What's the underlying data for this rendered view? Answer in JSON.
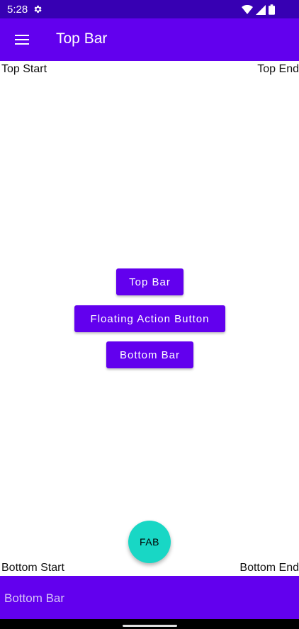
{
  "status_bar": {
    "time": "5:28",
    "icons": [
      "gear-icon",
      "wifi-icon",
      "signal-icon",
      "battery-icon"
    ]
  },
  "app_bar": {
    "title": "Top Bar",
    "nav_icon": "menu-icon"
  },
  "corners": {
    "top_start": "Top Start",
    "top_end": "Top End",
    "bottom_start": "Bottom Start",
    "bottom_end": "Bottom End"
  },
  "buttons": {
    "top_bar": "Top Bar",
    "fab": "Floating Action Button",
    "bottom_bar": "Bottom Bar"
  },
  "fab_label": "FAB",
  "bottom_bar_label": "Bottom Bar",
  "colors": {
    "primary": "#6200ee",
    "primary_dark": "#3700b3",
    "secondary": "#18d7c5"
  }
}
